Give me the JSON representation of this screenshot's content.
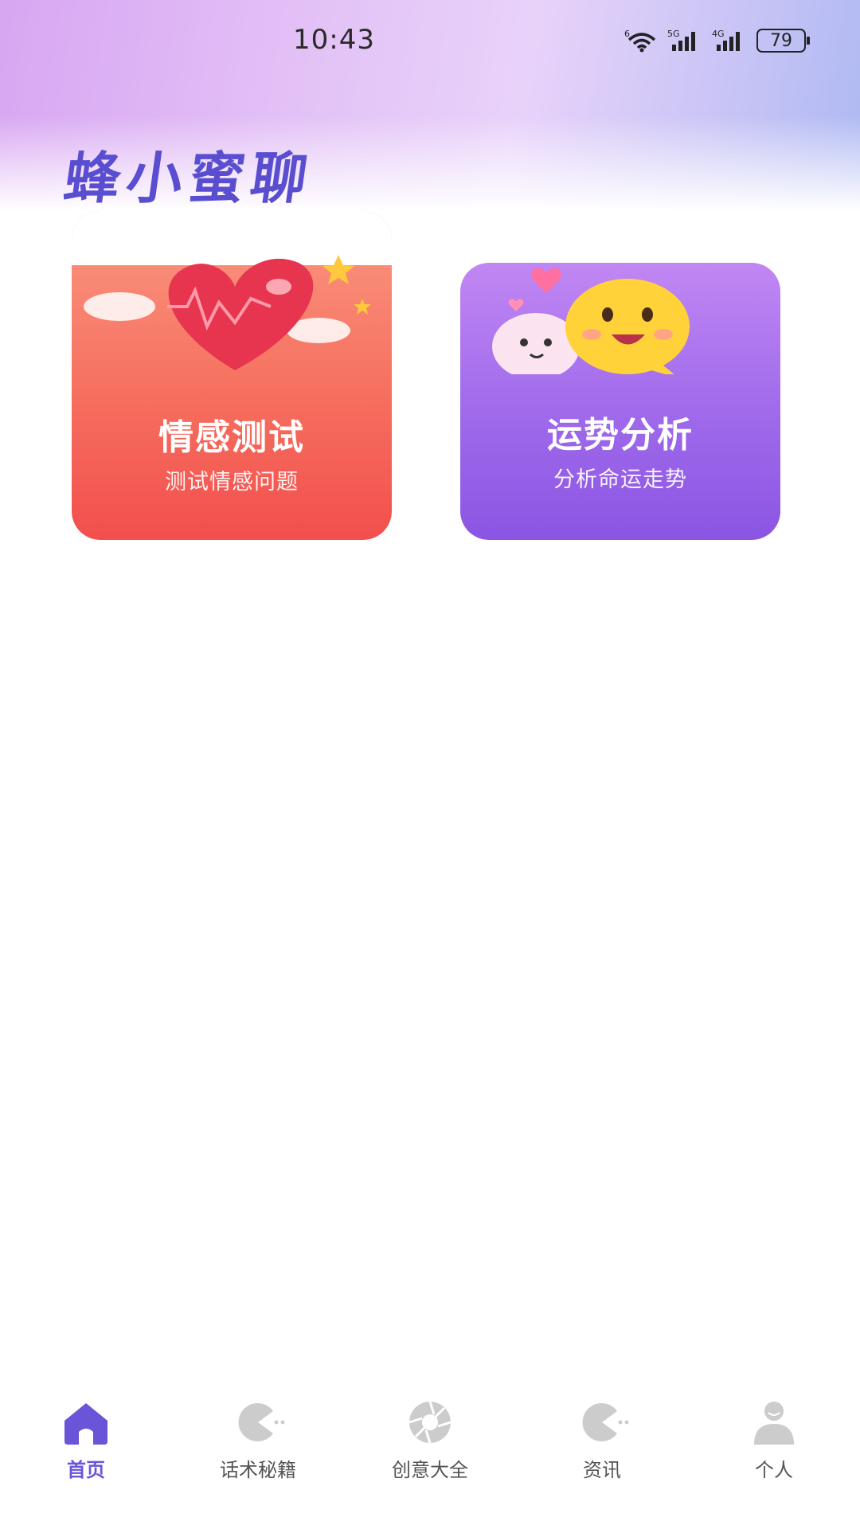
{
  "status_bar": {
    "time": "10:43",
    "network_label": "6",
    "sim1_label": "5G",
    "sim2_label": "4G",
    "battery": "79"
  },
  "app": {
    "title": "蜂小蜜聊"
  },
  "cards": [
    {
      "title": "情感测试",
      "subtitle": "测试情感问题"
    },
    {
      "title": "运势分析",
      "subtitle": "分析命运走势"
    }
  ],
  "tabbar": {
    "items": [
      {
        "label": "首页",
        "icon": "home-icon",
        "active": true
      },
      {
        "label": "话术秘籍",
        "icon": "pacman-icon",
        "active": false
      },
      {
        "label": "创意大全",
        "icon": "aperture-icon",
        "active": false
      },
      {
        "label": "资讯",
        "icon": "pacman-icon",
        "active": false
      },
      {
        "label": "个人",
        "icon": "person-icon",
        "active": false
      }
    ]
  },
  "colors": {
    "accent": "#6a55d8",
    "love_card": "#f6705f",
    "fortune_card": "#a26cec",
    "inactive_icon": "#cccccc"
  }
}
